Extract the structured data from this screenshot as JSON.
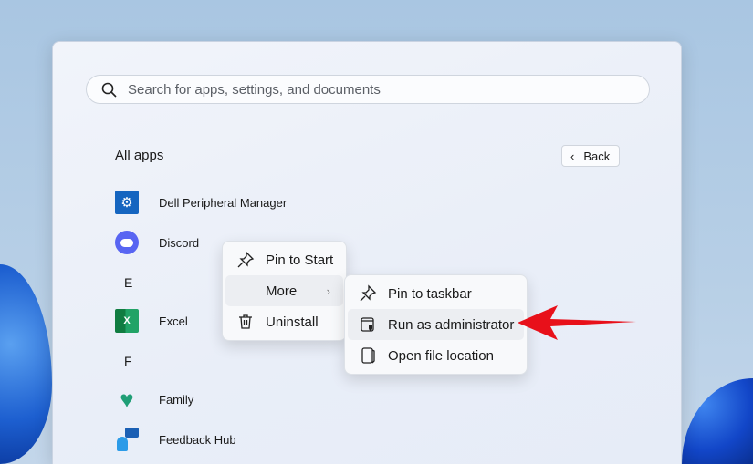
{
  "search": {
    "placeholder": "Search for apps, settings, and documents"
  },
  "all_apps": {
    "title": "All apps",
    "back_label": "Back"
  },
  "apps": [
    {
      "name": "Dell Peripheral Manager"
    },
    {
      "name": "Discord"
    },
    {
      "letter": "E"
    },
    {
      "name": "Excel"
    },
    {
      "letter": "F"
    },
    {
      "name": "Family"
    },
    {
      "name": "Feedback Hub"
    }
  ],
  "context_menu": {
    "items": [
      "Pin to Start",
      "More",
      "Uninstall"
    ]
  },
  "submenu": {
    "items": [
      "Pin to taskbar",
      "Run as administrator",
      "Open file location"
    ]
  },
  "colors": {
    "arrow": "#e8101a",
    "accent": "#0f6cbd"
  }
}
